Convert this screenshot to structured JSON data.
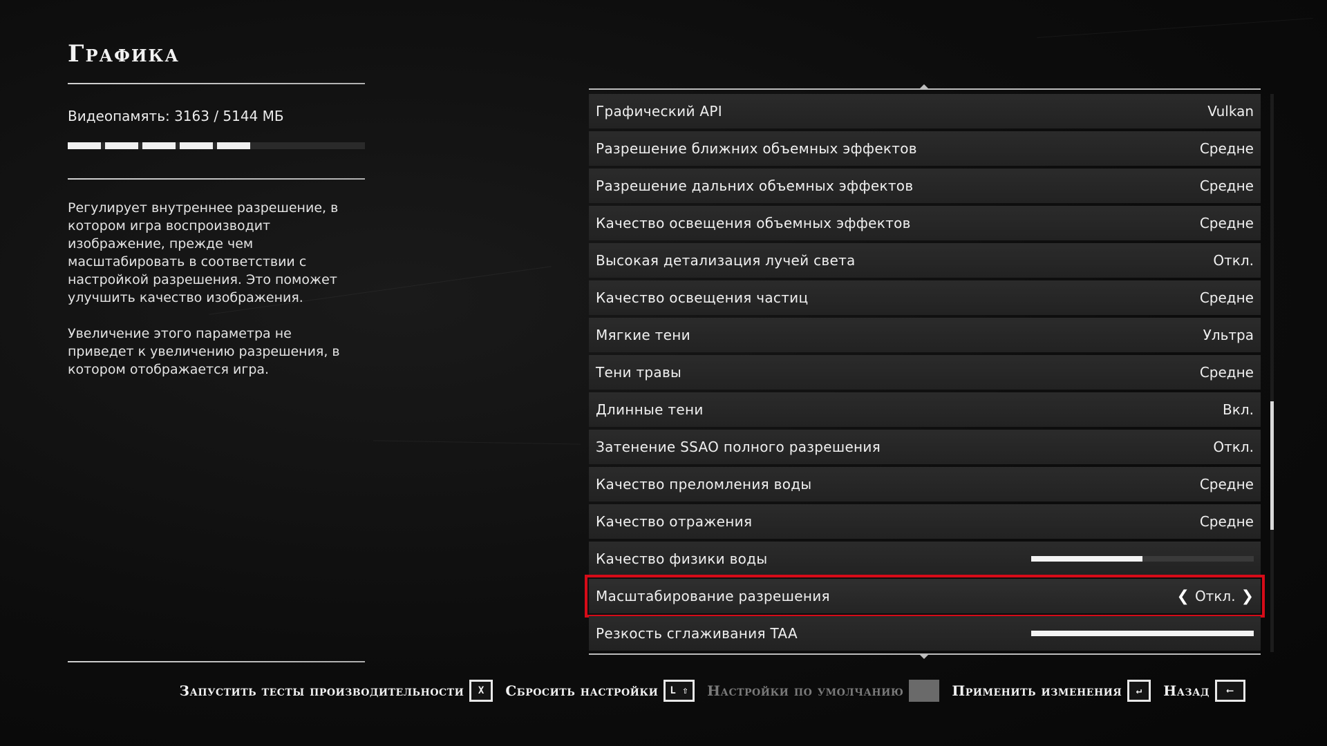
{
  "page": {
    "title": "Графика"
  },
  "vram": {
    "label": "Видеопамять:  3163  /  5144  МБ",
    "used": 3163,
    "total": 5144
  },
  "description": "Регулирует внутреннее разрешение, в котором игра воспроизводит изображение, прежде чем масштабировать в соответствии с настройкой разрешения. Это поможет улучшить качество изображения.\n\nУвеличение этого параметра не приведет к увеличению разрешения, в котором отображается игра.",
  "settings": [
    {
      "label": "Графический API",
      "value": "Vulkan"
    },
    {
      "label": "Разрешение ближних объемных эффектов",
      "value": "Средне"
    },
    {
      "label": "Разрешение дальних объемных эффектов",
      "value": "Средне"
    },
    {
      "label": "Качество освещения объемных эффектов",
      "value": "Средне"
    },
    {
      "label": "Высокая детализация лучей света",
      "value": "Откл."
    },
    {
      "label": "Качество освещения частиц",
      "value": "Средне"
    },
    {
      "label": "Мягкие тени",
      "value": "Ультра"
    },
    {
      "label": "Тени травы",
      "value": "Средне"
    },
    {
      "label": "Длинные тени",
      "value": "Вкл."
    },
    {
      "label": "Затенение SSAO полного разрешения",
      "value": "Откл."
    },
    {
      "label": "Качество преломления воды",
      "value": "Средне"
    },
    {
      "label": "Качество отражения",
      "value": "Средне"
    },
    {
      "label": "Качество физики воды",
      "slider_level": 0.5
    },
    {
      "label": "Масштабирование разрешения",
      "value": "Откл.",
      "selected": true
    },
    {
      "label": "Резкость сглаживания TAA",
      "slider_level": 1.0
    }
  ],
  "scrollbar": {
    "position_fraction": 0.65,
    "thumb_fraction": 0.23
  },
  "actions": [
    {
      "label": "Запустить тесты производительности",
      "key": "X",
      "enabled": true
    },
    {
      "label": "Сбросить настройки",
      "key": "L ⇧",
      "enabled": true
    },
    {
      "label": "Настройки по умолчанию",
      "key": "␣",
      "enabled": false
    },
    {
      "label": "Применить изменения",
      "key": "↵",
      "enabled": true
    },
    {
      "label": "Назад",
      "key": "⟵",
      "enabled": true
    }
  ],
  "colors": {
    "selection_outline": "#d60b18",
    "text": "#f0f0f0",
    "disabled_text": "#7a7a7a"
  }
}
